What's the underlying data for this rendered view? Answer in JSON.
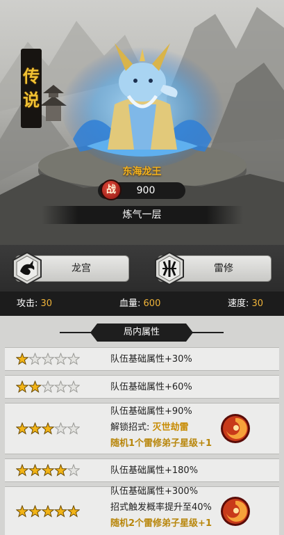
{
  "hero": {
    "rarity_label": "传说",
    "rarity_chars": [
      "传",
      "说"
    ],
    "name": "东海龙王",
    "power_emblem": "战",
    "power": "900",
    "realm": "炼气一层"
  },
  "factions": {
    "left": {
      "label": "龙宫",
      "icon": "dragon-crest-icon"
    },
    "right": {
      "label": "雷修",
      "icon": "thunder-crest-icon"
    }
  },
  "stats": {
    "attack_label": "攻击:",
    "attack_value": "30",
    "hp_label": "血量:",
    "hp_value": "600",
    "speed_label": "速度:",
    "speed_value": "30"
  },
  "panel": {
    "title": "局内属性",
    "rows": [
      {
        "stars": 1,
        "lines": [
          "队伍基础属性+30%"
        ]
      },
      {
        "stars": 2,
        "lines": [
          "队伍基础属性+60%"
        ]
      },
      {
        "stars": 3,
        "lines": [
          "队伍基础属性+90%",
          "解锁招式:",
          "灭世劫雷",
          "随机1个雷修弟子星级+1"
        ]
      },
      {
        "stars": 4,
        "lines": [
          "队伍基础属性+180%"
        ]
      },
      {
        "stars": 5,
        "lines": [
          "队伍基础属性+300%",
          "招式触发概率提升至40%",
          "随机2个雷修弟子星级+1"
        ]
      }
    ]
  },
  "colors": {
    "gold": "#f3b21f",
    "star_filled": "#f2b417",
    "star_empty": "#e3e3e0",
    "highlight": "#b8860b",
    "panel_bg": "#d4d4d2",
    "dark_bar": "#1c1c1c"
  }
}
